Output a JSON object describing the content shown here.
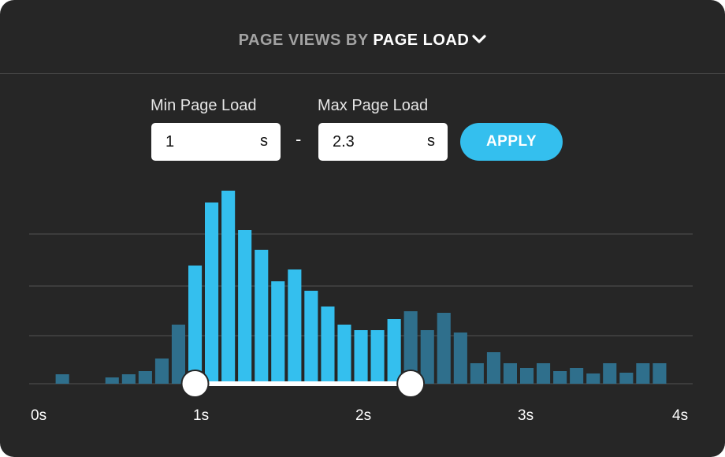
{
  "header": {
    "title_prefix": "PAGE VIEWS BY",
    "title_dropdown": "PAGE LOAD",
    "dropdown_icon": "chevron-down-icon"
  },
  "filters": {
    "min_label": "Min Page Load",
    "min_value": "1",
    "min_unit": "s",
    "separator": "-",
    "max_label": "Max Page Load",
    "max_value": "2.3",
    "max_unit": "s",
    "apply_label": "APPLY"
  },
  "colors": {
    "accent": "#34bfee",
    "bar_selected": "#34bfee",
    "bar_unselected": "#2f6f8c",
    "background": "#262626",
    "grid": "#444444"
  },
  "slider": {
    "min_value": 1,
    "max_value": 2.3
  },
  "chart_data": {
    "type": "bar",
    "x_tick_labels": [
      "0s",
      "1s",
      "2s",
      "3s",
      "4s"
    ],
    "xlim": [
      0,
      4
    ],
    "bin_width": 0.1,
    "x": [
      0.2,
      0.5,
      0.6,
      0.7,
      0.8,
      0.9,
      1.0,
      1.1,
      1.2,
      1.3,
      1.4,
      1.5,
      1.6,
      1.7,
      1.8,
      1.9,
      2.0,
      2.1,
      2.2,
      2.3,
      2.4,
      2.5,
      2.6,
      2.7,
      2.8,
      2.9,
      3.0,
      3.1,
      3.2,
      3.3,
      3.4,
      3.5,
      3.6,
      3.7,
      3.8,
      3.9
    ],
    "values": [
      12,
      8,
      12,
      16,
      32,
      75,
      150,
      230,
      245,
      195,
      170,
      130,
      145,
      118,
      98,
      75,
      68,
      68,
      82,
      92,
      68,
      90,
      65,
      26,
      40,
      26,
      20,
      26,
      16,
      20,
      13,
      26,
      14,
      26,
      26,
      0
    ],
    "ylim": [
      0,
      260
    ],
    "grid": true,
    "selected_range": [
      1,
      2.3
    ]
  }
}
